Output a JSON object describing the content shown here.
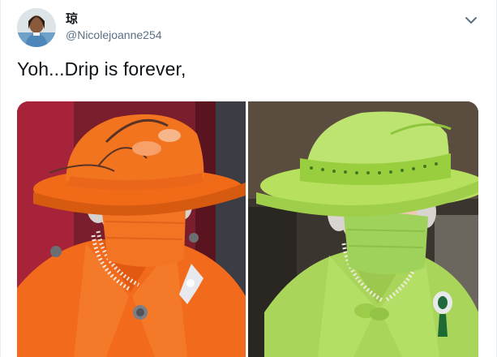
{
  "tweet": {
    "display_name": "琼",
    "handle": "@Nicolejoanne254",
    "text": "Yoh...Drip is forever,"
  },
  "icons": {
    "avatar": "avatar-photo",
    "menu": "chevron-down-icon"
  },
  "media": {
    "photos": [
      {
        "subject": "orange-outfit-photo",
        "accent": "#f26a1b"
      },
      {
        "subject": "green-outfit-photo",
        "accent": "#a9d65a"
      }
    ]
  },
  "colors": {
    "text": "#0f1419",
    "muted": "#5b7083",
    "border": "#e6ecf0"
  }
}
